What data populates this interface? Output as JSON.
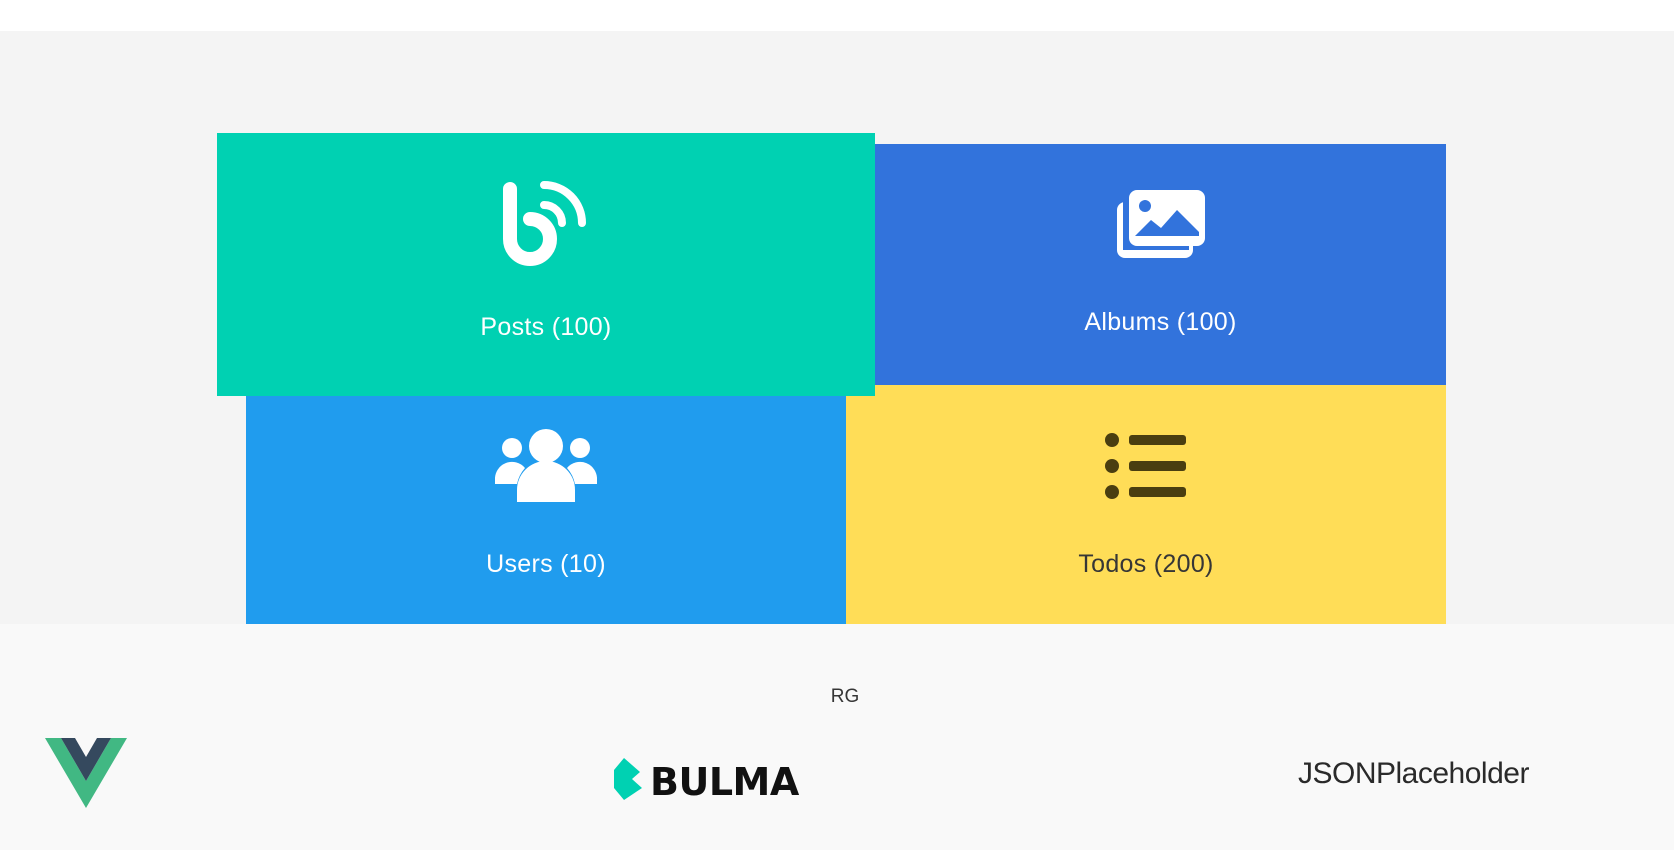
{
  "tiles": {
    "posts": {
      "label": "Posts (100)",
      "icon": "blog-feed-icon",
      "color": "#00d1b2"
    },
    "albums": {
      "label": "Albums (100)",
      "icon": "images-icon",
      "color": "#3273dc"
    },
    "users": {
      "label": "Users (10)",
      "icon": "users-group-icon",
      "color": "#209cee"
    },
    "todos": {
      "label": "Todos (200)",
      "icon": "list-icon",
      "color": "#ffdd57"
    }
  },
  "footer": {
    "credit": "RG",
    "vue_logo": "vue-logo-icon",
    "bulma_logo_text": "BULMA",
    "jsonplaceholder_text": "JSONPlaceholder"
  }
}
